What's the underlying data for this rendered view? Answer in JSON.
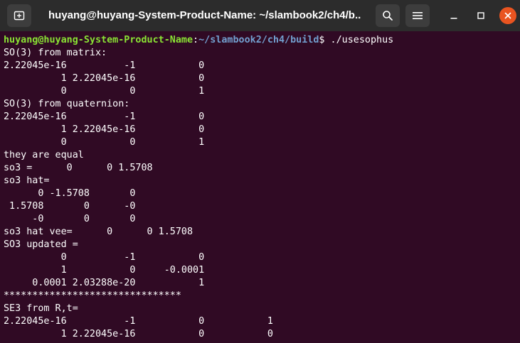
{
  "window": {
    "title": "huyang@huyang-System-Product-Name: ~/slambook2/ch4/b..."
  },
  "prompt": {
    "user_host": "huyang@huyang-System-Product-Name",
    "separator": ":",
    "path": "~/slambook2/ch4/build",
    "symbol": "$",
    "command": " ./usesophus"
  },
  "output": [
    "SO(3) from matrix:",
    "2.22045e-16          -1           0",
    "          1 2.22045e-16           0",
    "          0           0           1",
    "SO(3) from quaternion:",
    "2.22045e-16          -1           0",
    "          1 2.22045e-16           0",
    "          0           0           1",
    "they are equal",
    "so3 =      0      0 1.5708",
    "so3 hat=",
    "      0 -1.5708       0",
    " 1.5708       0      -0",
    "     -0       0       0",
    "so3 hat vee=      0      0 1.5708",
    "SO3 updated =",
    "          0          -1           0",
    "          1           0     -0.0001",
    "     0.0001 2.03288e-20           1",
    "*******************************",
    "SE3 from R,t=",
    "2.22045e-16          -1           0           1",
    "          1 2.22045e-16           0           0"
  ]
}
